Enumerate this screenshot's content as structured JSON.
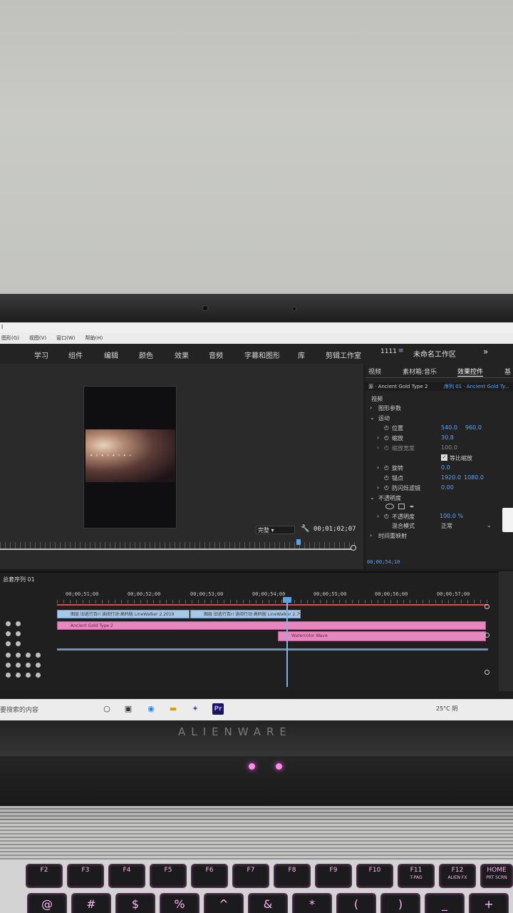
{
  "title_bar": {
    "text": "l"
  },
  "menu": {
    "items": [
      "图形(G)",
      "视图(V)",
      "窗口(W)",
      "帮助(H)"
    ]
  },
  "workspaces": {
    "tabs": [
      "学习",
      "组件",
      "编辑",
      "颜色",
      "效果",
      "音频",
      "字幕和图形",
      "库",
      "剪辑工作室"
    ],
    "number": "1111",
    "name": "未命名工作区",
    "more": "»"
  },
  "program_monitor": {
    "fit_label": "完整",
    "timecode": "00;01;02;07"
  },
  "effects_panel": {
    "tabs": [
      "视频",
      "素材箱:音乐",
      "效果控件",
      "基"
    ],
    "clip_name": "源 · Ancient Gold Type 2",
    "sequence_name": "序列 01 · Ancient Gold Ty...",
    "rows": [
      {
        "label": "视频",
        "values": []
      },
      {
        "label": "图形参数",
        "values": []
      },
      {
        "label": "运动",
        "values": []
      },
      {
        "label": "位置",
        "values": [
          "540.0",
          "960.0"
        ]
      },
      {
        "label": "缩放",
        "values": [
          "30.8"
        ]
      },
      {
        "label": "缩放宽度",
        "values": [
          "100.0"
        ]
      },
      {
        "label": "等比缩放",
        "values": []
      },
      {
        "label": "旋转",
        "values": [
          "0.0"
        ]
      },
      {
        "label": "锚点",
        "values": [
          "1920.0",
          "1080.0"
        ]
      },
      {
        "label": "防闪烁滤镜",
        "values": [
          "0.00"
        ]
      },
      {
        "label": "不透明度",
        "values": []
      },
      {
        "label": "不透明度",
        "values": [
          "100.0 %"
        ]
      },
      {
        "label": "混合模式",
        "values": [
          "正常"
        ]
      },
      {
        "label": "时间重映射",
        "values": []
      }
    ],
    "timecode": "00;00;54;10"
  },
  "timeline": {
    "sequence": "总套序列 01",
    "ruler": [
      "00;00;51;00",
      "00;00;52;00",
      "00;00;53;00",
      "00;00;54;00",
      "00;00;55;00",
      "00;00;56;00",
      "00;00;57;00"
    ],
    "clips": [
      {
        "label": "图层 旧逃行百ri 读阅行动·高码版 LineWalker 2.2019",
        "color": "blue"
      },
      {
        "label": "图层 旧逃行百ri 读阅行动·高码版 LineWalker 2.79",
        "color": "blue"
      },
      {
        "label": "Ancient Gold Type 2",
        "color": "pink"
      },
      {
        "label": "Watercolor Wave",
        "color": "pink"
      }
    ]
  },
  "taskbar": {
    "search": "要搜索的内容",
    "weather": "25°C 阴",
    "app_pr": "Pr"
  },
  "laptop": {
    "brand": "ALIENWARE"
  },
  "keyboard": {
    "fkeys": [
      "F2",
      "F3",
      "F4",
      "F5",
      "F6",
      "F7",
      "F8",
      "F9",
      "F10",
      "F11",
      "F12",
      "HOME"
    ],
    "fkey_sub": [
      "",
      "",
      "",
      "",
      "",
      "",
      "",
      "",
      "",
      "T-PAD",
      "ALIEN FX",
      "PRT SCRN"
    ],
    "bottom": [
      "@",
      "#",
      "$",
      "%",
      "^",
      "&",
      "*",
      "(",
      ")",
      "_",
      "+"
    ]
  },
  "colors": {
    "accent": "#5aa7ff",
    "clip_blue": "#a8c8e8",
    "clip_pink": "#e688c0",
    "playhead": "#5aa2e6",
    "in_out_bar": "#e14848"
  }
}
